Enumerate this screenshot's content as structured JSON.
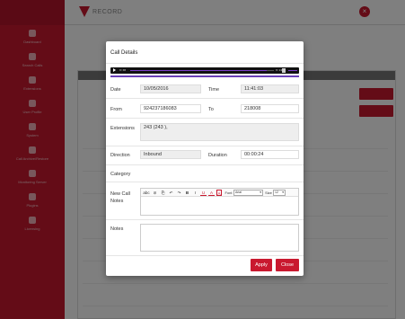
{
  "app": {
    "logo_text": "RECORD",
    "close_glyph": "×"
  },
  "sidebar": {
    "items": [
      {
        "label": "Dashboard",
        "icon": "home-icon"
      },
      {
        "label": "Search Calls",
        "icon": "search-icon"
      },
      {
        "label": "Extensions",
        "icon": "phone-icon"
      },
      {
        "label": "User Profile",
        "icon": "user-icon"
      },
      {
        "label": "System",
        "icon": "wrench-icon"
      },
      {
        "label": "Call Archive/Restore",
        "icon": "folder-icon"
      },
      {
        "label": "Monitoring Server",
        "icon": "gear-icon"
      },
      {
        "label": "Plugins",
        "icon": "plug-icon"
      },
      {
        "label": "Licensing",
        "icon": "doc-icon"
      }
    ]
  },
  "modal": {
    "title": "Call Details",
    "player": {
      "current": "0:00",
      "duration": "0:24",
      "progress_pct": 95,
      "volume_pct": 100
    },
    "date_label": "Date",
    "date_value": "10/05/2016",
    "time_label": "Time",
    "time_value": "11:41:03",
    "from_label": "From",
    "from_value": "924237186083",
    "to_label": "To",
    "to_value": "218008",
    "extensions_label": "Extensions",
    "extensions_value": "243 (243 ),",
    "direction_label": "Direction",
    "direction_value": "Inbound",
    "duration_label": "Duration",
    "duration_value": "00:00:24",
    "category_label": "Category",
    "new_notes_label": "New Call Notes",
    "notes_label": "Notes",
    "toolbar": {
      "items": [
        "abc",
        "⊘",
        "⎘",
        "↶",
        "↷",
        "B",
        "I",
        "U",
        "A",
        "Ā"
      ],
      "font_label": "Font",
      "font_value": "Arial",
      "size_label": "Size",
      "size_value": "12"
    },
    "apply_label": "Apply",
    "close_label": "Close"
  }
}
